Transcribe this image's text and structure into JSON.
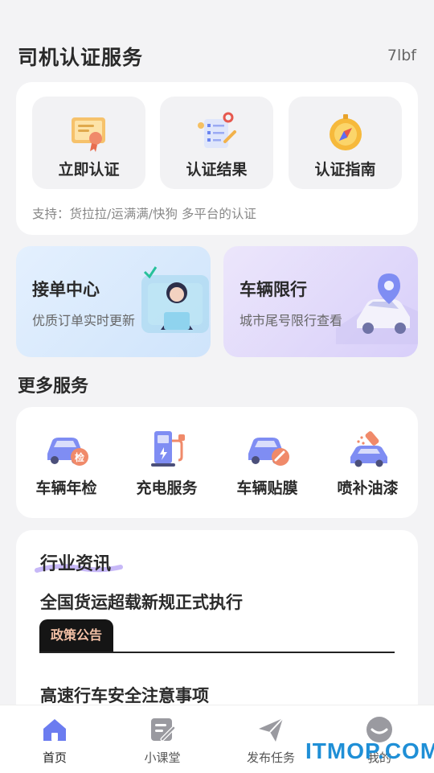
{
  "header": {
    "title": "司机认证服务",
    "weather": "7lbf"
  },
  "certification": {
    "items": [
      {
        "label": "立即认证",
        "icon": "certificate-icon"
      },
      {
        "label": "认证结果",
        "icon": "clipboard-check-icon"
      },
      {
        "label": "认证指南",
        "icon": "compass-icon"
      }
    ],
    "support_text": "支持：货拉拉/运满满/快狗 多平台的认证"
  },
  "promos": [
    {
      "title": "接单中心",
      "subtitle": "优质订单实时更新",
      "icon": "customer-service-agent-icon"
    },
    {
      "title": "车辆限行",
      "subtitle": "城市尾号限行查看",
      "icon": "car-location-icon"
    }
  ],
  "more_services": {
    "title": "更多服务",
    "items": [
      {
        "label": "车辆年检",
        "icon": "car-inspection-icon"
      },
      {
        "label": "充电服务",
        "icon": "charging-station-icon"
      },
      {
        "label": "车辆贴膜",
        "icon": "car-film-icon"
      },
      {
        "label": "喷补油漆",
        "icon": "spray-paint-icon"
      }
    ]
  },
  "news": {
    "title": "行业资讯",
    "headline": "全国货运超载新规正式执行",
    "tag": "政策公告",
    "headline2": "高速行车安全注意事项"
  },
  "tabbar": {
    "items": [
      {
        "label": "首页",
        "icon": "home-icon",
        "active": true
      },
      {
        "label": "小课堂",
        "icon": "edit-note-icon",
        "active": false
      },
      {
        "label": "发布任务",
        "icon": "send-icon",
        "active": false
      },
      {
        "label": "我的",
        "icon": "profile-icon",
        "active": false
      }
    ]
  },
  "watermark": "ITMOP.COM",
  "colors": {
    "accent": "#5b6ef5",
    "tab_active": "#6b7cf0",
    "tab_inactive": "#9a9aa0",
    "tag_text": "#f4c1a6"
  }
}
